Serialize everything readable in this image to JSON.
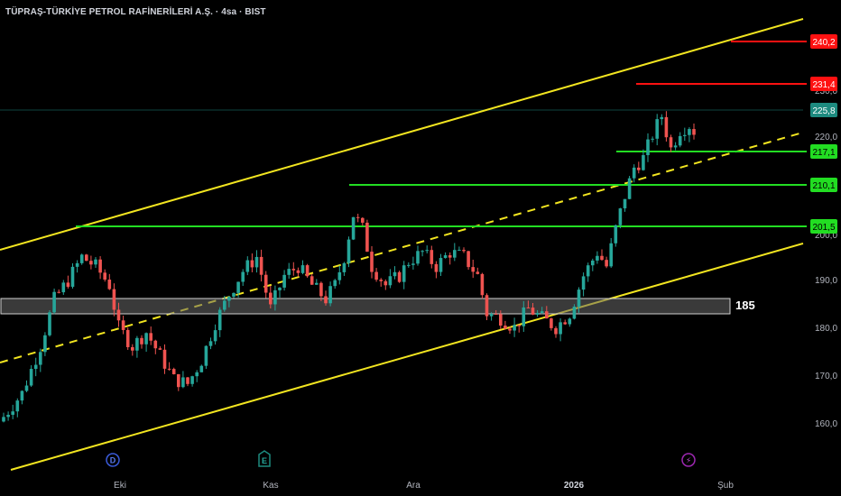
{
  "header": {
    "title": "TÜPRAŞ-TÜRKİYE PETROL RAFİNERİLERİ A.Ş. · 4sa · BIST"
  },
  "colors": {
    "background": "#000000",
    "up": "#26a69a",
    "down": "#ef5350",
    "channel": "#f2e520",
    "support": "#22dd22",
    "resistance": "#ff1111",
    "last_price": "#1d8a7f",
    "zone_fill": "#6a6a6a",
    "axis_text": "#b2b5be"
  },
  "chart_data": {
    "type": "candlestick",
    "title": "TÜPRAŞ-TÜRKİYE PETROL RAFİNERİLERİ A.Ş. · 4sa · BIST",
    "ylim": [
      152,
      245
    ],
    "y_ticks": [
      "160,0",
      "170,0",
      "180,0",
      "190,0",
      "200,0",
      "210,0",
      "220,0",
      "230,0"
    ],
    "x_ticks": [
      "Eki",
      "Kas",
      "Ara",
      "2026",
      "Şub"
    ],
    "last_price": {
      "label": "225,8",
      "value": 225.8
    },
    "horizontal_levels": [
      {
        "label": "240,2",
        "value": 240.2,
        "kind": "resistance"
      },
      {
        "label": "231,4",
        "value": 231.4,
        "kind": "resistance"
      },
      {
        "label": "217,1",
        "value": 217.1,
        "kind": "support"
      },
      {
        "label": "210,1",
        "value": 210.1,
        "kind": "support"
      },
      {
        "label": "201,5",
        "value": 201.5,
        "kind": "support"
      }
    ],
    "zone": {
      "label": "185",
      "low": 183.2,
      "high": 186.4
    },
    "event_markers": [
      "D",
      "E",
      "⚡"
    ],
    "close_path": [
      [
        0,
        165
      ],
      [
        4,
        170
      ],
      [
        8,
        180
      ],
      [
        11,
        190
      ],
      [
        14,
        194
      ],
      [
        17,
        199
      ],
      [
        20,
        197
      ],
      [
        23,
        193
      ],
      [
        25,
        184
      ],
      [
        28,
        180
      ],
      [
        31,
        183
      ],
      [
        34,
        178
      ],
      [
        37,
        173
      ],
      [
        40,
        172
      ],
      [
        43,
        177
      ],
      [
        46,
        185
      ],
      [
        49,
        191
      ],
      [
        52,
        196
      ],
      [
        55,
        199
      ],
      [
        58,
        188
      ],
      [
        61,
        195
      ],
      [
        64,
        197
      ],
      [
        67,
        193
      ],
      [
        70,
        190
      ],
      [
        72,
        193
      ],
      [
        74,
        199
      ],
      [
        76,
        208
      ],
      [
        78,
        205
      ],
      [
        80,
        197
      ],
      [
        83,
        193
      ],
      [
        86,
        195
      ],
      [
        88,
        198
      ],
      [
        91,
        200
      ],
      [
        94,
        197
      ],
      [
        97,
        200
      ],
      [
        100,
        199
      ],
      [
        103,
        195
      ],
      [
        105,
        187
      ],
      [
        108,
        186
      ],
      [
        111,
        184
      ],
      [
        114,
        188
      ],
      [
        117,
        186
      ],
      [
        120,
        184
      ],
      [
        123,
        187
      ],
      [
        126,
        195
      ],
      [
        129,
        200
      ],
      [
        131,
        197
      ],
      [
        133,
        205
      ],
      [
        135,
        212
      ],
      [
        137,
        218
      ],
      [
        139,
        220
      ],
      [
        141,
        225
      ],
      [
        143,
        229
      ],
      [
        145,
        222
      ],
      [
        147,
        226
      ],
      [
        149,
        227
      ],
      [
        150,
        225.8
      ]
    ]
  }
}
